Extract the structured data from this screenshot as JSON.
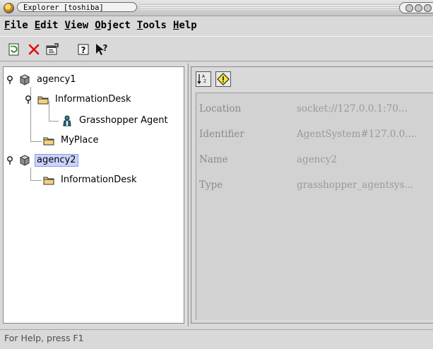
{
  "window": {
    "title": "Explorer [toshiba]"
  },
  "menu": [
    {
      "label": "File",
      "mnemonic": "F"
    },
    {
      "label": "Edit",
      "mnemonic": "E"
    },
    {
      "label": "View",
      "mnemonic": "V"
    },
    {
      "label": "Object",
      "mnemonic": "O"
    },
    {
      "label": "Tools",
      "mnemonic": "T"
    },
    {
      "label": "Help",
      "mnemonic": "H"
    }
  ],
  "toolbar": {
    "buttons": [
      {
        "icon": "refresh-icon"
      },
      {
        "icon": "delete-icon"
      },
      {
        "icon": "properties-icon"
      },
      {
        "icon": "help-icon"
      },
      {
        "icon": "context-help-icon"
      }
    ]
  },
  "tree": {
    "agency1": {
      "label": "agency1",
      "icon": "agency-icon"
    },
    "agency1_infodesk": {
      "label": "InformationDesk",
      "icon": "folder-icon"
    },
    "agency1_agent": {
      "label": "Grasshopper Agent",
      "icon": "agent-icon"
    },
    "agency1_myplace": {
      "label": "MyPlace",
      "icon": "folder-icon"
    },
    "agency2": {
      "label": "agency2",
      "icon": "agency-icon",
      "selected": true
    },
    "agency2_infodesk": {
      "label": "InformationDesk",
      "icon": "folder-icon"
    }
  },
  "detail": {
    "toolbar": [
      {
        "icon": "sort-icon"
      },
      {
        "icon": "warning-icon"
      }
    ],
    "properties": [
      {
        "name": "Location",
        "value": "socket://127.0.0.1:70..."
      },
      {
        "name": "Identifier",
        "value": "AgentSystem#127.0.0...."
      },
      {
        "name": "Name",
        "value": "agency2"
      },
      {
        "name": "Type",
        "value": "grasshopper_agentsys..."
      }
    ]
  },
  "status": {
    "text": "For Help, press F1"
  },
  "colors": {
    "selection": "#ccd3ff",
    "background": "#d9d9d9",
    "folder": "#f2d27a",
    "agent": "#1f7a7a"
  }
}
